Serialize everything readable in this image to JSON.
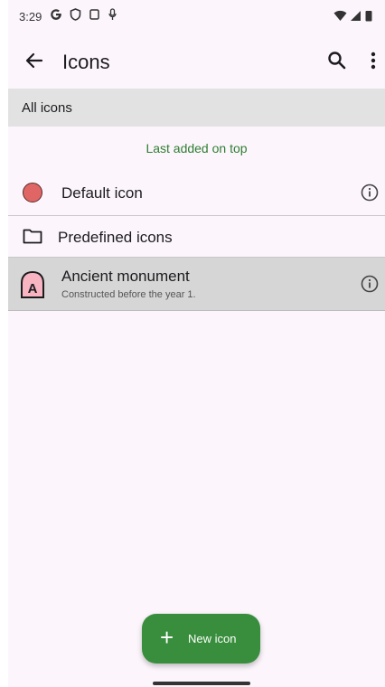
{
  "status_bar": {
    "time": "3:29",
    "left_icons": [
      "google-g-icon",
      "shield-icon",
      "clipboard-icon",
      "mic-icon"
    ],
    "right_icons": [
      "wifi-icon",
      "signal-icon",
      "battery-icon"
    ]
  },
  "app_bar": {
    "title": "Icons",
    "back_icon": "arrow-left-icon",
    "search_icon": "search-icon",
    "menu_icon": "more-vert-icon"
  },
  "section_header": "All icons",
  "sort_label": "Last added on top",
  "rows": [
    {
      "label": "Default icon",
      "icon": "red-circle-icon",
      "accent": "#e06666",
      "info": true
    },
    {
      "label": "Predefined icons",
      "icon": "folder-icon"
    },
    {
      "label": "Ancient monument",
      "subtitle": "Constructed before the year 1.",
      "icon": "monument-a-icon",
      "accent": "#f8b4c0",
      "info": true,
      "selected": true
    }
  ],
  "fab": {
    "icon": "plus",
    "label": "New icon",
    "color": "#388e3c"
  },
  "colors": {
    "accent_green": "#2e7d32",
    "background": "#fcf6fc",
    "header_bg": "#e2e2e2"
  }
}
